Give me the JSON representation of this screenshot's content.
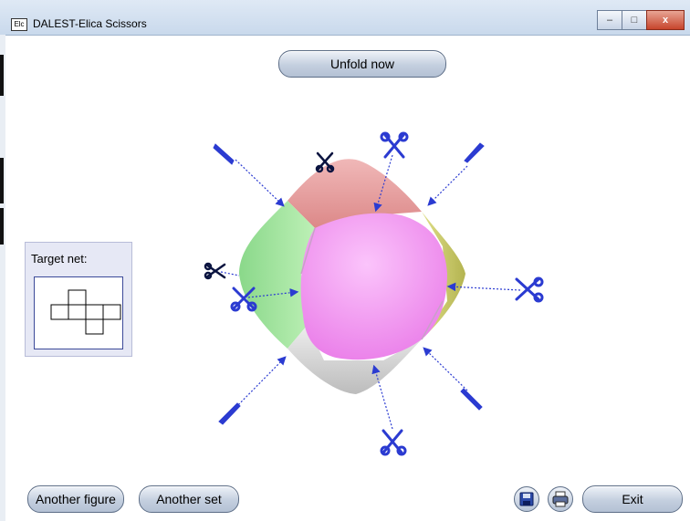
{
  "window": {
    "title": "DALEST-Elica Scissors",
    "icon_label": "Elc",
    "controls": {
      "minimize": "–",
      "maximize": "□",
      "close": "x"
    }
  },
  "buttons": {
    "unfold": "Unfold now",
    "another_figure": "Another figure",
    "another_set": "Another set",
    "exit": "Exit"
  },
  "icons": {
    "save": "save-icon",
    "print": "printer-icon",
    "scissors": "scissors-icon",
    "knife": "knife-icon"
  },
  "target_net": {
    "label": "Target net:"
  },
  "colors": {
    "top_face": "#e7a0a0",
    "left_face": "#a8e8a0",
    "right_face": "#cfcf70",
    "bottom_face": "#d9d9d9",
    "front_face": "#f38df2",
    "tool": "#2b3bd1",
    "tool_dark": "#0b1440"
  }
}
